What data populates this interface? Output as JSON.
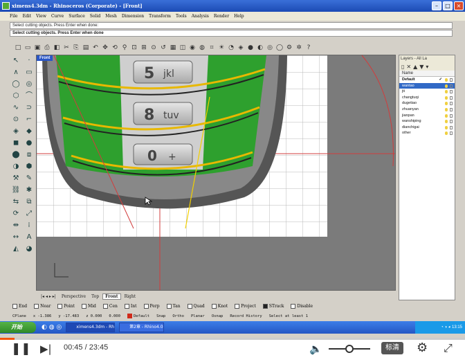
{
  "window": {
    "title": "ximens4.3dm - Rhinoceros (Corporate) - [Front]"
  },
  "menu": [
    "File",
    "Edit",
    "View",
    "Curve",
    "Surface",
    "Solid",
    "Mesh",
    "Dimension",
    "Transform",
    "Tools",
    "Analysis",
    "Render",
    "Help"
  ],
  "command": {
    "history": "Select cutting objects. Press Enter when done:",
    "prompt": "Select cutting objects. Press Enter when done"
  },
  "viewport": {
    "label": "Front",
    "keys": [
      {
        "digit": "5",
        "letters": "jkl"
      },
      {
        "digit": "8",
        "letters": "tuv"
      },
      {
        "digit": "0",
        "letters": "+"
      }
    ]
  },
  "layers": {
    "title": "Layers - All La",
    "column": "Name",
    "items": [
      {
        "name": "Default",
        "current": true
      },
      {
        "name": "wantao",
        "selected": true
      },
      {
        "name": "jti"
      },
      {
        "name": "changtuqi"
      },
      {
        "name": "dugetiao"
      },
      {
        "name": "zhuanyan"
      },
      {
        "name": "jianpan"
      },
      {
        "name": "wanshiping"
      },
      {
        "name": "dianchigai"
      },
      {
        "name": "other"
      }
    ]
  },
  "tabs": [
    "Perspective",
    "Top",
    "Front",
    "Right"
  ],
  "active_tab": "Front",
  "osnap": [
    "End",
    "Near",
    "Point",
    "Mid",
    "Cen",
    "Int",
    "Perp",
    "Tan",
    "Quad",
    "Knot",
    "Project",
    "STrack",
    "Disable"
  ],
  "osnap_checked": [
    "STrack"
  ],
  "status": {
    "plane": "CPlane",
    "x": "x -1.386",
    "y": "y -17.483",
    "z": "z 0.000",
    "val": "0.000",
    "layer": "Default",
    "snap": "Snap",
    "ortho": "Ortho",
    "planar": "Planar",
    "osnap": "Osnap",
    "record": "Record History",
    "selectat": "Select at least 1"
  },
  "taskbar": {
    "start": "开始",
    "tasks": [
      "ximens4.3dm - Rh",
      "第2章 - Rhino4.0"
    ],
    "time": "13:15"
  },
  "player": {
    "current": "00:45",
    "duration": "23:45",
    "quality": "标清",
    "progress": 0.0316,
    "volume": 0.5
  },
  "colors": {
    "accent": "#f5550a",
    "viewport_bg": "#7b7b7b",
    "surface_green": "#2ea02e",
    "selected": "#3169c6"
  }
}
